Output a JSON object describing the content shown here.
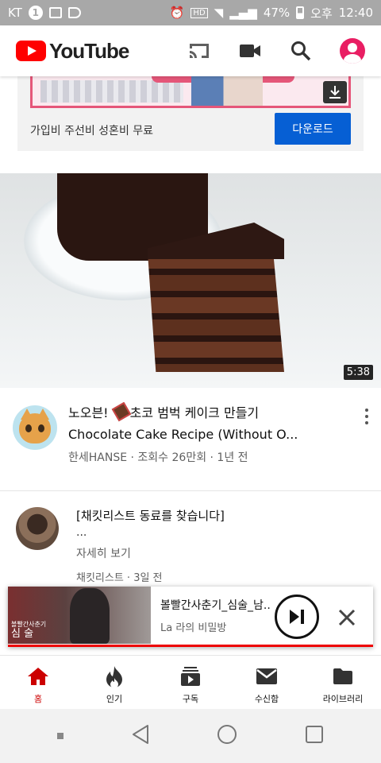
{
  "statusbar": {
    "carrier": "KT",
    "carrier_badge": "1",
    "battery": "47%",
    "ampm": "오후",
    "time": "12:40"
  },
  "header": {
    "logo_text": "YouTube",
    "brand_color": "#ff0000",
    "icons": [
      "cast-icon",
      "camera-icon",
      "search-icon",
      "account-icon"
    ]
  },
  "ad": {
    "text": "가입비 주선비 성혼비 무료",
    "button_label": "다운로드"
  },
  "video": {
    "duration": "5:38",
    "title_line1_a": "노오븐! ",
    "title_line1_b": "초코 범벅 케이크 만들기",
    "title_line2": "Chocolate Cake Recipe (Without O...",
    "meta": "한세HANSE · 조회수 26만회 · 1년 전"
  },
  "post": {
    "title": "[채킷리스트 동료를 찾습니다]",
    "ellipsis": "...",
    "more": "자세히 보기",
    "meta": "채킷리스트 · 3일 전"
  },
  "miniplayer": {
    "thumb_small": "볼빨간사춘기",
    "thumb_big": "심 술",
    "title": "볼빨간사춘기_심술_남..",
    "channel": "La 라의 비밀방",
    "progress": 1.0
  },
  "bottomnav": {
    "items": [
      {
        "label": "홈",
        "active": true
      },
      {
        "label": "인기",
        "active": false
      },
      {
        "label": "구독",
        "active": false
      },
      {
        "label": "수신함",
        "active": false
      },
      {
        "label": "라이브러리",
        "active": false
      }
    ]
  }
}
